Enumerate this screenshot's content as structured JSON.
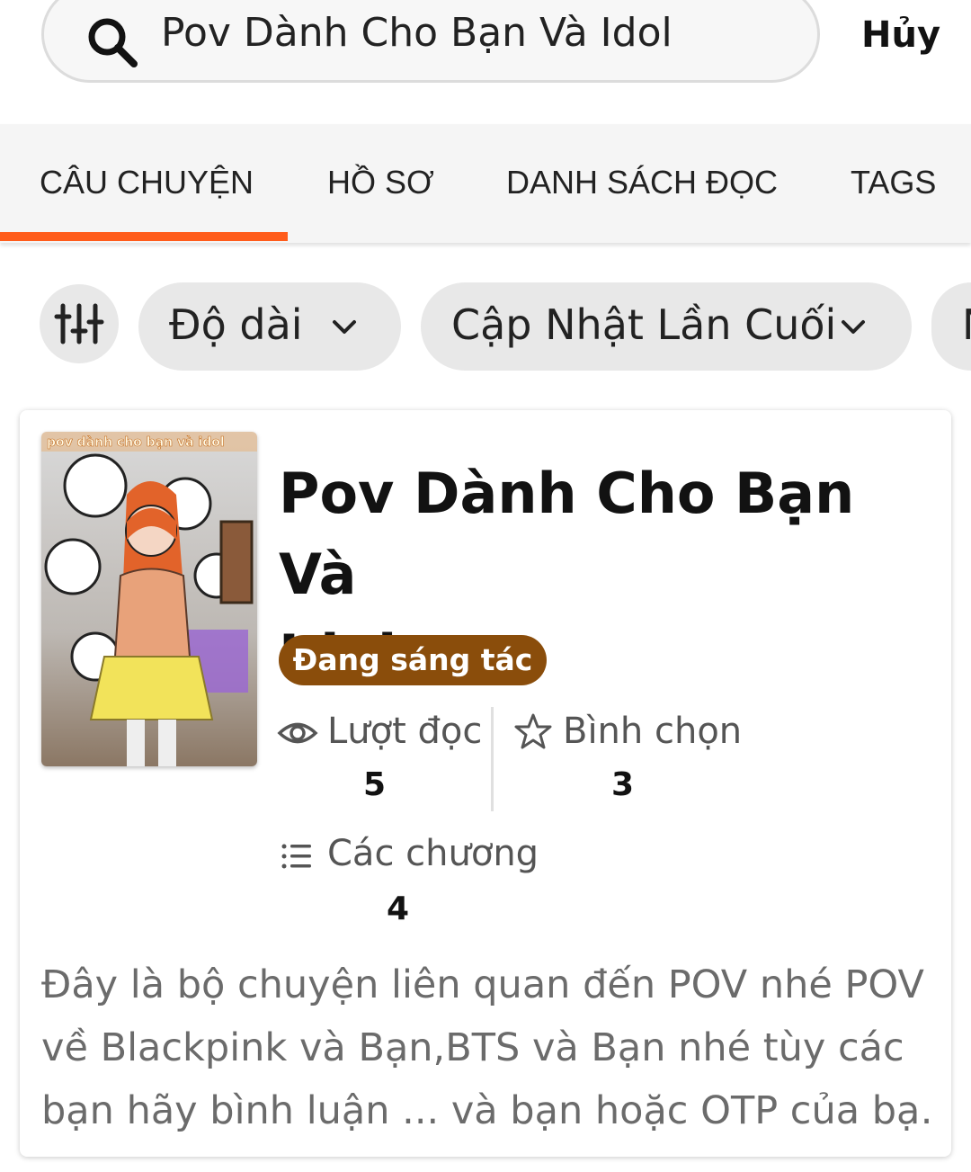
{
  "search": {
    "query": "Pov Dành Cho Bạn Và Idol",
    "cancel_label": "Hủy"
  },
  "tabs": [
    {
      "label": "CÂU CHUYỆN",
      "active": true
    },
    {
      "label": "HỒ SƠ"
    },
    {
      "label": "DANH SÁCH ĐỌC"
    },
    {
      "label": "TAGS"
    }
  ],
  "filters": [
    {
      "label": "Độ dài"
    },
    {
      "label": "Cập Nhật Lần Cuối"
    },
    {
      "label": "N"
    }
  ],
  "story": {
    "title_line1": "Pov Dành Cho Bạn Và",
    "title_line2": "Idol",
    "cover_text": "pov dành cho bạn và idol",
    "status": "Đang sáng tác",
    "reads_label": "Lượt đọc",
    "reads": "5",
    "votes_label": "Bình chọn",
    "votes": "3",
    "chapters_label": "Các chương",
    "chapters": "4",
    "description_lines": [
      "Đây là bộ chuyện liên quan đến POV nhé POV",
      "về Blackpink và Bạn,BTS và Bạn nhé tùy các",
      "bạn hãy bình luận ... và bạn hoặc OTP của bạ…"
    ]
  },
  "colors": {
    "accent": "#ff5c1b",
    "status_badge": "#8a4d0b"
  }
}
